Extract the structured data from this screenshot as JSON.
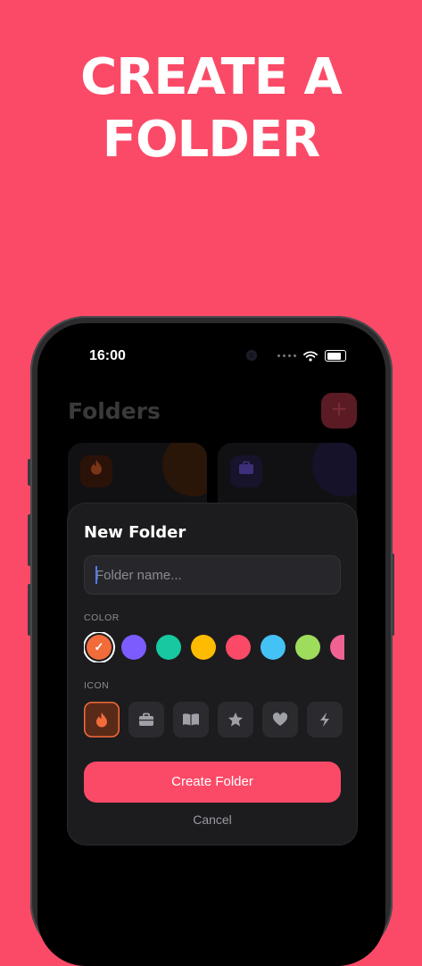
{
  "headline": {
    "line1": "CREATE A",
    "line2": "FOLDER"
  },
  "status_bar": {
    "time": "16:00"
  },
  "background_app": {
    "title": "Folders",
    "add_button_label": "+",
    "cards": [
      {
        "icon": "flame-icon",
        "accent": "#f26b3a"
      },
      {
        "icon": "briefcase-icon",
        "accent": "#7c5cff"
      }
    ]
  },
  "modal": {
    "title": "New Folder",
    "name_input": {
      "placeholder": "Folder name...",
      "value": ""
    },
    "color_section_label": "COLOR",
    "colors": [
      "#f26b3a",
      "#7c5cff",
      "#16c9a0",
      "#ffbb00",
      "#fb4a67",
      "#45c2f5",
      "#9edc5b",
      "#f06292"
    ],
    "selected_color": "#f26b3a",
    "selected_check": "✓",
    "icon_section_label": "ICON",
    "icons": [
      "flame-icon",
      "briefcase-icon",
      "book-icon",
      "star-icon",
      "heart-icon",
      "bolt-icon"
    ],
    "selected_icon": "flame-icon",
    "create_button_label": "Create Folder",
    "cancel_button_label": "Cancel"
  },
  "colors": {
    "page_background": "#fb4a67",
    "accent": "#fb4a67",
    "modal_background": "#1c1c1f"
  }
}
